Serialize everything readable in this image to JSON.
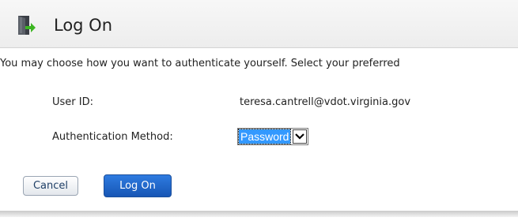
{
  "dialog": {
    "title": "Log On",
    "title_icon": "door-exit-icon",
    "intro_text": "You may choose how you want to authenticate yourself. Select your preferred"
  },
  "form": {
    "user_id_label": "User ID:",
    "user_id_value": "teresa.cantrell@vdot.virginia.gov",
    "auth_method_label": "Authentication Method:",
    "auth_method_selected": "Password"
  },
  "buttons": {
    "cancel_label": "Cancel",
    "logon_label": "Log On"
  },
  "colors": {
    "primary_button": "#1f66cc",
    "selection_highlight": "#3399ff",
    "titlebar": "#f0f0f0"
  }
}
